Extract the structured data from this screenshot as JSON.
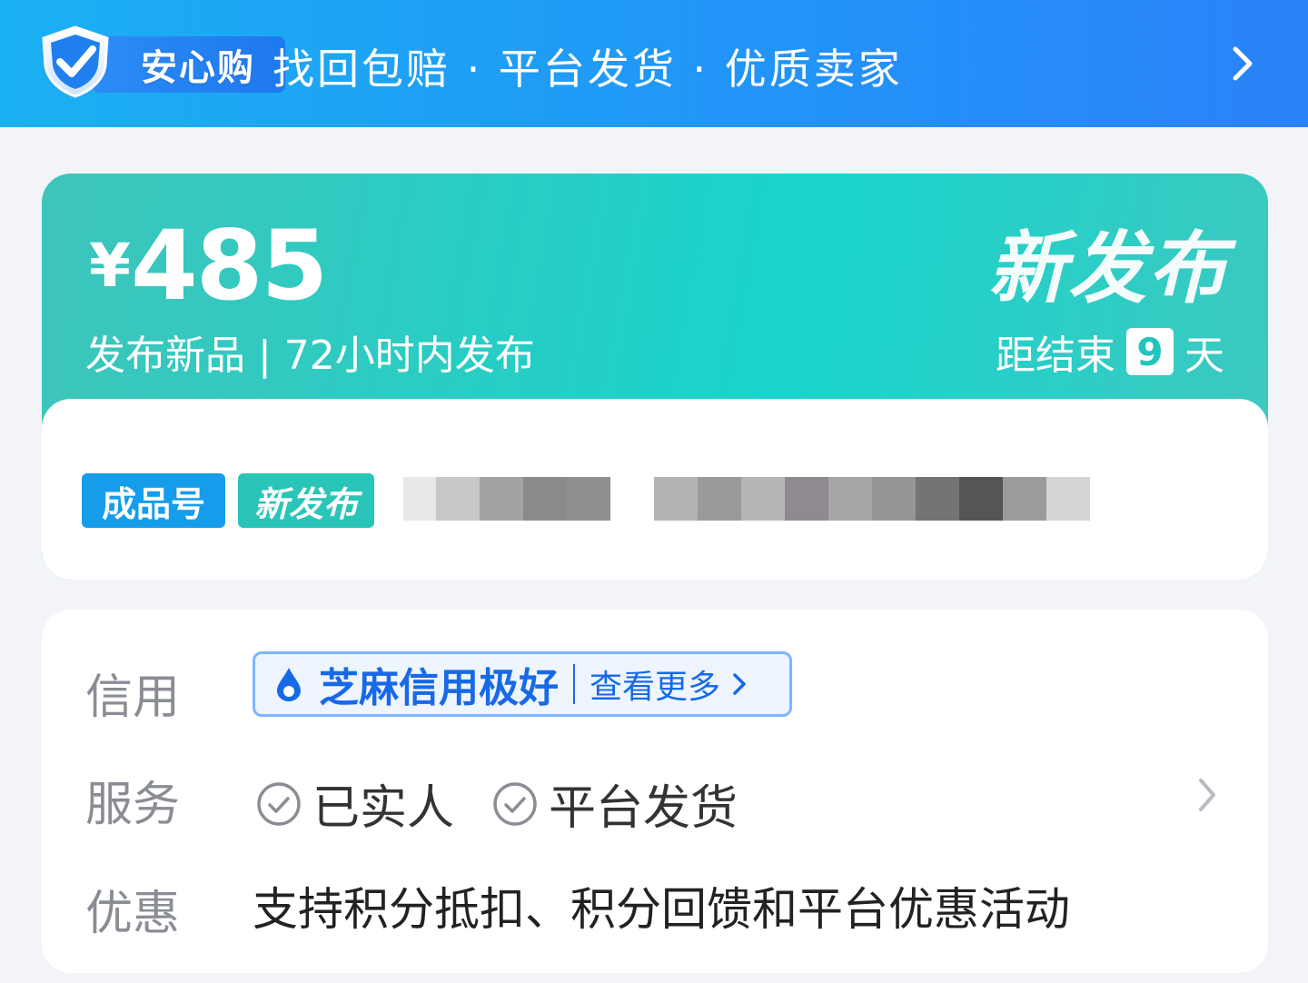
{
  "banner": {
    "logo_text": "安心购",
    "slogan": "找回包赔 · 平台发货 · 优质卖家"
  },
  "release": {
    "currency": "¥",
    "price": "485",
    "subtitle": "发布新品 | 72小时内发布",
    "title": "新发布",
    "countdown_prefix": "距结束",
    "countdown_days": "9",
    "countdown_suffix": "天",
    "tags": [
      "成品号",
      "新发布"
    ]
  },
  "info": {
    "credit_label": "信用",
    "credit_value": "芝麻信用极好",
    "credit_more": "查看更多",
    "service_label": "服务",
    "services": [
      "已实人",
      "平台发货"
    ],
    "promo_label": "优惠",
    "promo_text": "支持积分抵扣、积分回馈和平台优惠活动"
  },
  "colors": {
    "banner_blue": "#1ea4f4",
    "teal": "#22cfc6",
    "tag_blue": "#159dec",
    "credit_blue": "#1869e8"
  },
  "icons": [
    "shield-check-icon",
    "chevron-right-icon",
    "water-drop-icon",
    "check-circle-icon"
  ]
}
